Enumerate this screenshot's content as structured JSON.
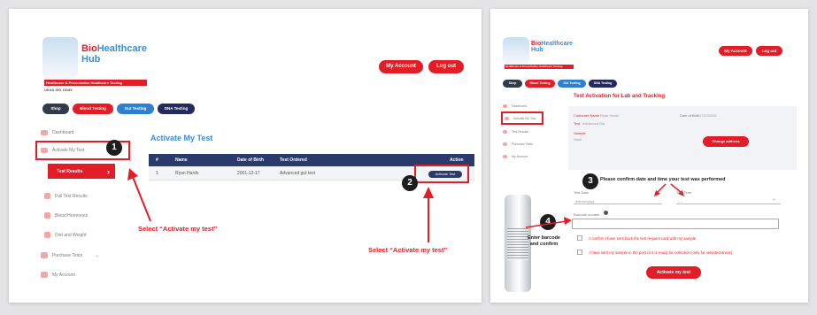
{
  "left": {
    "logo": {
      "name_line1_red": "Bio",
      "name_line1_blue": "Healthcare",
      "name_line2": "Hub",
      "banner": "Healthcare & Preventative Healthcare Testing",
      "small_text": "UKAS ISO 15189"
    },
    "header_buttons": {
      "my_account": "My Account",
      "log_out": "Log out"
    },
    "nav_pills": [
      "Shop",
      "Blood Testing",
      "Gut Testing",
      "DNA Testing"
    ],
    "sidebar": {
      "items": [
        "Dashboard",
        "Activate My Test",
        "Test Results",
        "Full Test Results",
        "Blood Hormones",
        "Diet and Weight",
        "Purchase Tests",
        "My Account"
      ],
      "chevron": "›"
    },
    "page_title": "Activate My Test",
    "table": {
      "headers": [
        "#",
        "Name",
        "Date of Birth",
        "Test Ordered",
        "Action"
      ],
      "row": [
        "1",
        "Ryan Hards",
        "2001-12-17",
        "Advanced gut test"
      ],
      "action_label": "Activate Test"
    },
    "steps": [
      "1",
      "2"
    ],
    "callouts": [
      "Select “Activate my test”",
      "Select “Activate my test”"
    ]
  },
  "right": {
    "header_buttons": {
      "my_account": "My Account",
      "log_out": "Log out"
    },
    "nav_pills": [
      "Shop",
      "Blood Testing",
      "Gut Testing",
      "DNA Testing"
    ],
    "title": "Test Activation for Lab and Tracking",
    "sidebar": [
      "Dashboard",
      "Activate My Test",
      "Test Results",
      "Purchase Tests",
      "My Account"
    ],
    "summary": {
      "labels": [
        "Customer Name",
        "Test",
        "Sample"
      ],
      "values": [
        "Ryan Hards",
        "Advanced Gut",
        "Stool"
      ],
      "dob_label": "Date of Birth",
      "dob_value": "17/12/2001",
      "reorder_label": "Change address"
    },
    "confirm_heading": "Please confirm date and time your test was performed",
    "date_label": "Test Date",
    "date_placeholder": "dd/mm/yyyy",
    "time_label": "Test Time",
    "time_placeholder": "--:--",
    "barcode_label": "Barcode number",
    "checks": [
      "I confirm I have sent back the test request card with my sample",
      "I have sent my sample in the post or it is ready for collection (only for selected areas)"
    ],
    "submit": "Activate my test",
    "steps": [
      "3",
      "4"
    ],
    "callout": [
      "Enter barcode",
      "and confirm"
    ]
  },
  "colors": {
    "brand_red": "#e21d27",
    "brand_blue": "#3a8ed8",
    "navy": "#2a3a6b",
    "background": "#e4e4e6"
  }
}
